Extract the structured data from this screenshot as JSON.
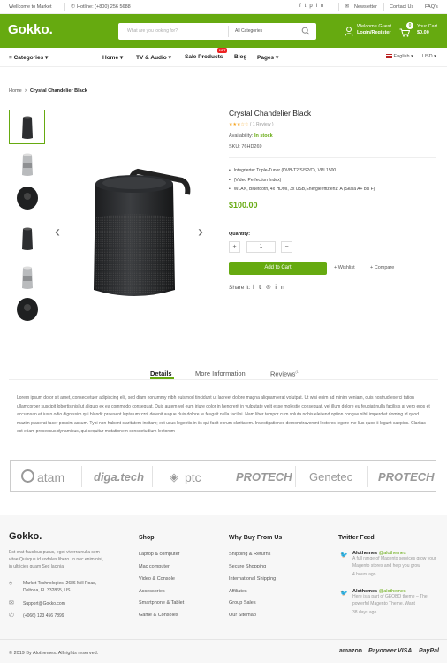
{
  "topbar": {
    "welcome": "Wellcome to Market",
    "hotline": "Hotline: (+800) 256 5688",
    "newsletter": "Newsletter",
    "contact": "Contact Us",
    "faq": "FAQ's"
  },
  "header": {
    "logo": "Gokko.",
    "search_placeholder": "What are you looking for?",
    "search_category": "All Categories",
    "account_line1": "Welcome Guest",
    "account_line2": "Login/Register",
    "cart_label": "Your Cart",
    "cart_total": "$0.00",
    "cart_count": "0"
  },
  "nav": {
    "categories": "Categories",
    "home": "Home",
    "tv_audio": "TV & Audio",
    "sale": "Sale Products",
    "hot_badge": "HOT",
    "blog": "Blog",
    "pages": "Pages",
    "language": "English",
    "currency": "USD"
  },
  "breadcrumb": {
    "home": "Home",
    "sep": ">",
    "current": "Crystal Chandelier Black"
  },
  "product": {
    "title": "Crystal Chandelier Black",
    "stars": "★★★☆☆",
    "reviews": "( 1 Review )",
    "availability_label": "Availability:",
    "availability_value": "In stock",
    "sku": "SKU: 76HD269",
    "features": [
      "Integrierter Triple-Tuner (DVB-T2/S/S2/C), VPI 1500",
      "(Video Perfection Index)",
      "WLAN, Bluetooth, 4x HDMI, 3x USB,Energieeffizienz: A (Skala A+ bis F)"
    ],
    "price": "$100.00",
    "quantity_label": "Quantity:",
    "quantity": "1",
    "minus": "+",
    "plus": "−",
    "add_to_cart": "Add to Cart",
    "wishlist": "+ Wishlist",
    "compare": "+ Compare",
    "share_label": "Share it:"
  },
  "tabs": {
    "details": "Details",
    "more_info": "More Information",
    "reviews": "Reviews",
    "reviews_count": "(1)"
  },
  "description": "Lorem ipsum dolor sit amet, consectetuer adipiscing elit, sed diam nonummy nibh euismod tincidunt ut laoreet dolore magna aliquam erat volutpat. Ut wisi enim ad minim veniam, quis nostrud exerci tation ullamcorper suscipit lobortis nisl ut aliquip ex ea commodo consequat. Duis autem vel eum iriure dolor in hendrerit in vulputate velit esse molestie consequat, vel illum dolore eu feugiat nulla facilisis at vero eros et accumsan et iusto odio dignissim qui blandit praesent luptatum zzril delenit augue duis dolore te feugait nulla facilisi. Nam liber tempor cum soluta nobis eleifend option congue nihil imperdiet doming id quod mazim placerat facer possim assum. Typi non habent claritatem insitam; est usus legentis in iis qui facit eorum claritatem. Investigationes demonstraverunt lectores legere me lius quod ii legunt saepius. Claritas est etiam processus dynamicus, qui sequitur mutationem consuetudium lectorum",
  "brands": [
    "atam",
    "diga.tech",
    "ptc",
    "PROTECH",
    "Genetec",
    "PROTECH"
  ],
  "footer": {
    "logo": "Gokko.",
    "about": "Est erat faucibus purus, eget viverra nulla sem vitae Quisque id sodales libero. In nec enim nisi, in ultricies quam Sed lacinia",
    "address_line1": "Market Technologies, 2686 Mill Road,",
    "address_line2": "Deltona, FL 332865, US.",
    "email": "Support@Gokko.com",
    "phone": "(+066) 123 456 7899",
    "shop_title": "Shop",
    "shop_links": [
      "Laptop & computer",
      "Mac computer",
      "Video & Console",
      "Accessories",
      "Smartphone & Tablet",
      "Game & Consoles"
    ],
    "why_title": "Why Buy From Us",
    "why_links": [
      "Shipping & Returns",
      "Secure Shopping",
      "International Shipping",
      "Affiliates",
      "Group Sales",
      "Our Sitemap"
    ],
    "twitter_title": "Twitter Feed",
    "tweets": [
      {
        "user": "Alothemes",
        "handle": "@alothemes",
        "text": "A full range of Magento services grow your Magento stores and help you grow",
        "time": "4 hours ago"
      },
      {
        "user": "Alothemes",
        "handle": "@alothemes",
        "text": "Here is a part of GEOBO theme – The powerful Magento Theme. Want",
        "time": "38 days ago"
      }
    ],
    "copyright": "© 2019 By Alothemes. All rights reserved.",
    "payments": [
      "amazon",
      "Payoneer",
      "VISA",
      "PayPal"
    ]
  },
  "colors": {
    "accent": "#66aa10",
    "hot": "#e22222"
  }
}
